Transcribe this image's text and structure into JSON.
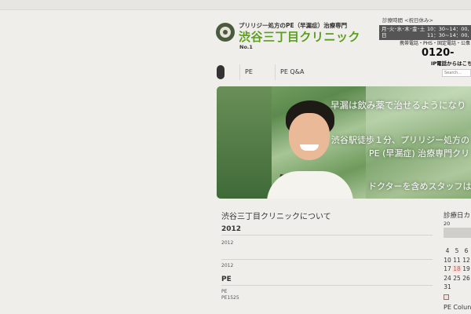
{
  "header": {
    "logo_tagline": "プリリジー処方のPE（早漏症）治療専門",
    "logo_name": "渋谷三丁目クリニック",
    "logo_badge": "No.1",
    "hours_title": "診療時間 <祝日休み>",
    "hours": [
      {
        "days": "月･火･水･木･金･土",
        "time": "10：30~14：00,"
      },
      {
        "days": "日",
        "time": "11：30~14：00,"
      }
    ],
    "contact_note": "携帯電話・PHS・固定電話・公衆",
    "tel": "0120-",
    "ip_note": "IP電話からはこち"
  },
  "nav": {
    "items": [
      {
        "label": "PE"
      },
      {
        "label": "PE Q&A"
      }
    ],
    "search_placeholder": "Search..."
  },
  "hero": {
    "line1": "早漏は飲み薬で治せるようになり",
    "line2": "渋谷駅徒歩１分、プリリジー処方の",
    "line3": "PE (早漏症) 治療専門クリ",
    "line4": "ドクターを含めスタッフは全"
  },
  "main": {
    "about_title": "渋谷三丁目クリニックについて",
    "sections": [
      {
        "title": "2012",
        "items": [
          "2012"
        ]
      },
      {
        "title": "",
        "items": [
          "2012"
        ]
      },
      {
        "title": "PE",
        "items": [
          "PE",
          "PE1525"
        ]
      }
    ]
  },
  "sidebar": {
    "calendar_title": "診療日カ",
    "calendar_header": "20",
    "calendar_rows": [
      [
        "4",
        "5",
        "6"
      ],
      [
        "10",
        "11",
        "12"
      ],
      [
        "17",
        "18",
        "19"
      ],
      [
        "24",
        "25",
        "26"
      ],
      [
        "31",
        "",
        ""
      ]
    ],
    "highlight_day": "18",
    "column_title": "PE Colun"
  },
  "colors": {
    "brand_green": "#5a9e1e",
    "hours_bg": "#555555",
    "holiday_red": "#c45a5a"
  }
}
